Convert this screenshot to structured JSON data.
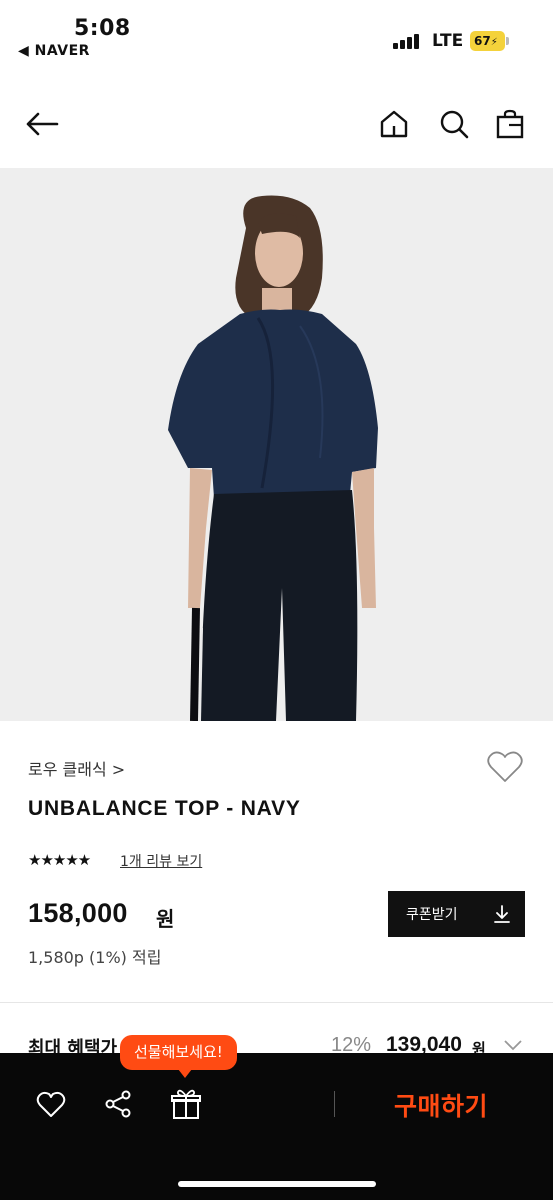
{
  "status_bar": {
    "time": "5:08",
    "back_app": "◀ NAVER",
    "network": "LTE",
    "battery": "67"
  },
  "nav": {
    "back_icon": "arrow-left-icon",
    "home_icon": "home-icon",
    "search_icon": "search-icon",
    "bag_icon": "shopping-bag-icon"
  },
  "product": {
    "image_description": "model-wearing-navy-top",
    "brand": "로우 클래식 >",
    "name": "UNBALANCE TOP - NAVY",
    "rating_stars": "★★★★★",
    "rating_value": 5,
    "review_link": "1개 리뷰 보기",
    "price": "158,000",
    "price_unit": "원",
    "coupon_label": "쿠폰받기",
    "points": "1,580p (1%) 적립"
  },
  "benefit": {
    "label": "최대 혜택가",
    "discount": "12%",
    "price": "139,040",
    "unit": "원"
  },
  "bottom_bar": {
    "gift_tooltip": "선물해보세요!",
    "buy_label": "구매하기"
  },
  "colors": {
    "accent": "#ff4b13",
    "battery": "#f4d23b",
    "navy": "#1e2e4a"
  }
}
